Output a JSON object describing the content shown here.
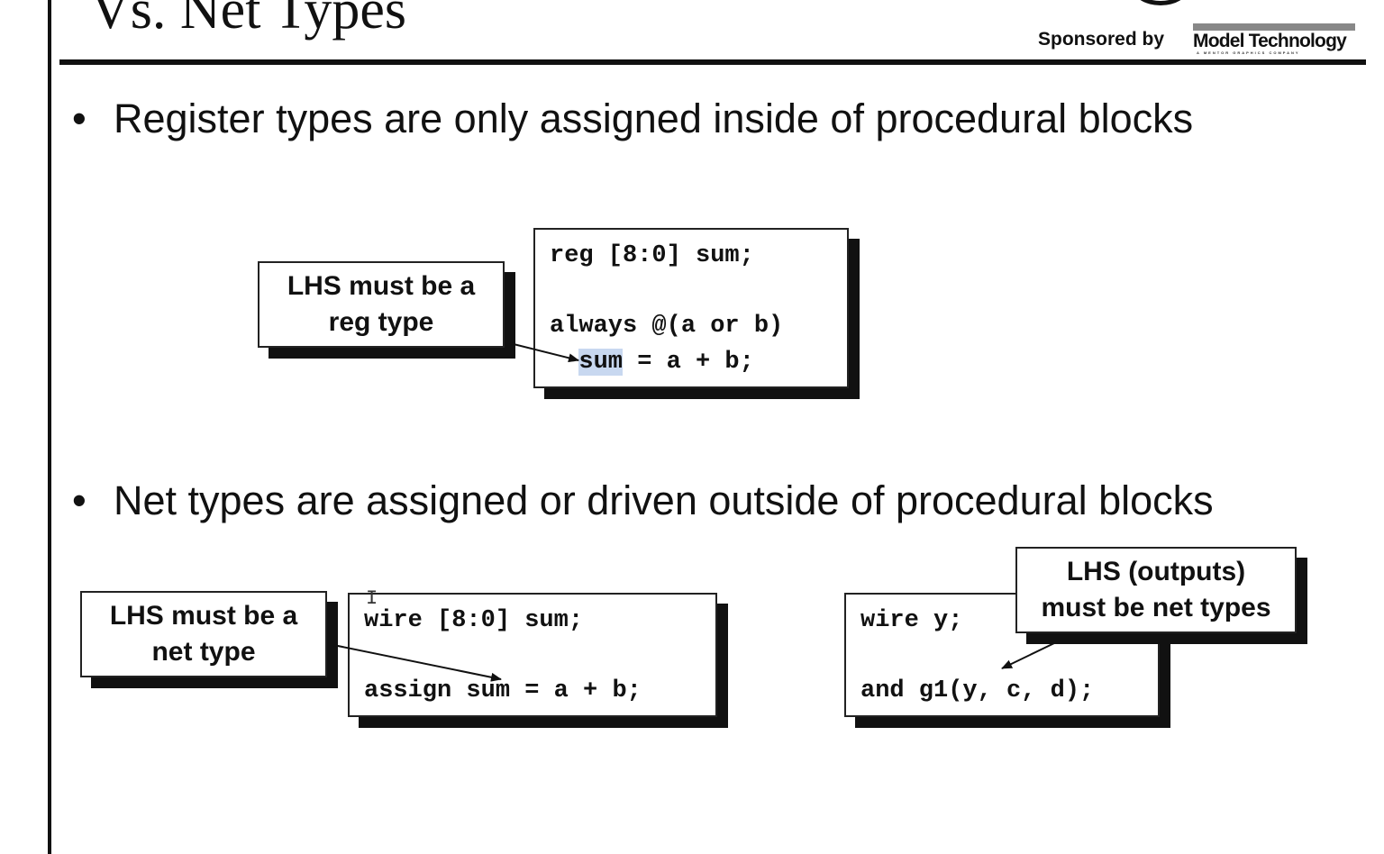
{
  "slide": {
    "title": "Vs. Net Types",
    "sponsor_label": "Sponsored by",
    "logo_name": "Model Technology",
    "logo_subtitle": "A MENTOR GRAPHICS COMPANY"
  },
  "bullets": [
    {
      "symbol": "•",
      "text": "Register types are only assigned inside of procedural blocks"
    },
    {
      "symbol": "•",
      "text": "Net types are assigned or driven outside of procedural blocks"
    }
  ],
  "reg_example": {
    "note_line1": "LHS must be a",
    "note_line2": "reg type",
    "code_line1": "reg [8:0] sum;",
    "code_line2": "always @(a or b)",
    "code_line3_indent": "  ",
    "code_line3_target": "sum",
    "code_line3_rest": " = a + b;"
  },
  "net_example": {
    "note_line1": "LHS must be a",
    "note_line2": "net type",
    "code_line1": "wire [8:0] sum;",
    "code_line2": "assign sum = a + b;"
  },
  "gate_example": {
    "note_line1": "LHS (outputs)",
    "note_line2": "must be net types",
    "code_line1": "wire y;",
    "code_line2": "and g1(y, c, d);"
  },
  "colors": {
    "highlight": "#c8d8f0",
    "text": "#111111",
    "logo_bar": "#888888"
  }
}
